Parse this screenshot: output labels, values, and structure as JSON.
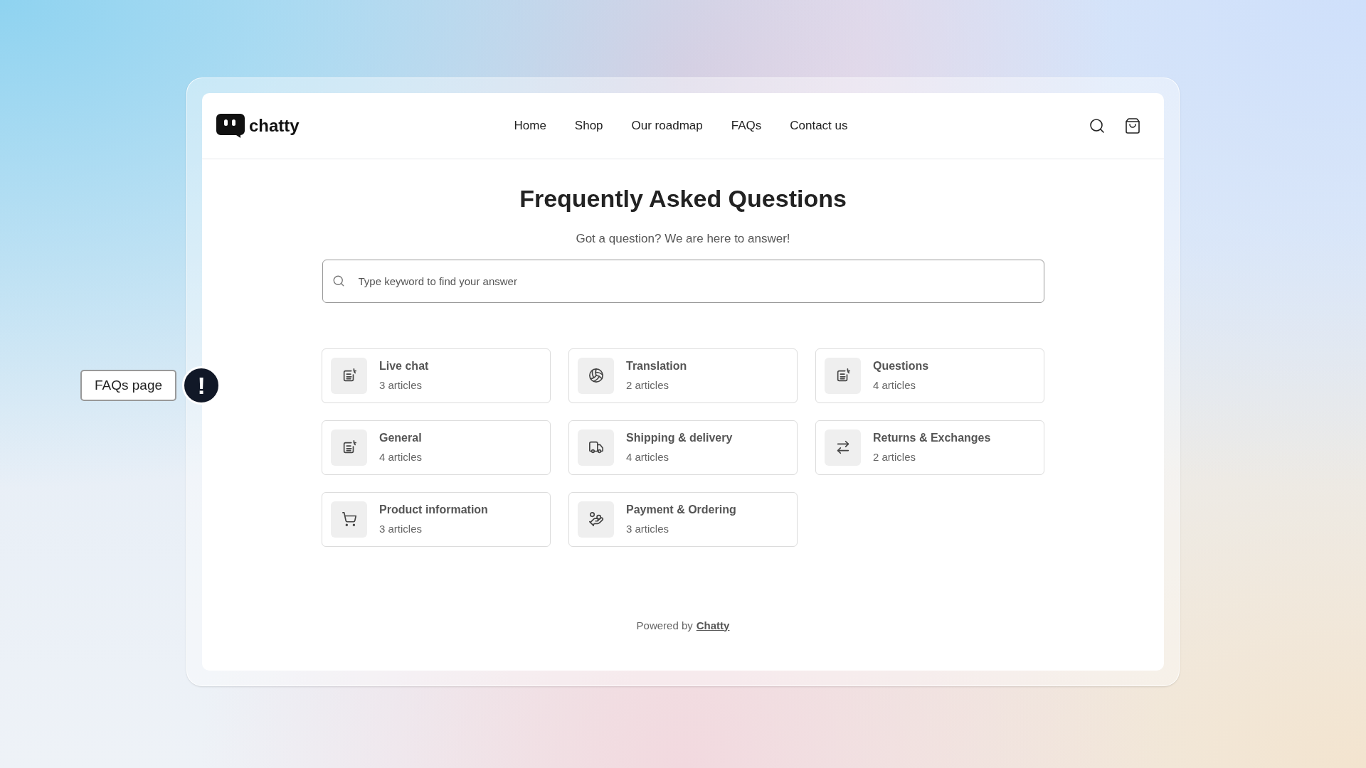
{
  "header": {
    "logo": "chatty",
    "nav": [
      {
        "label": "Home"
      },
      {
        "label": "Shop"
      },
      {
        "label": "Our roadmap"
      },
      {
        "label": "FAQs"
      },
      {
        "label": "Contact us"
      }
    ]
  },
  "page": {
    "title": "Frequently Asked Questions",
    "subtitle": "Got a question? We are here to answer!",
    "search": {
      "placeholder": "Type keyword to find your answer"
    }
  },
  "categories": [
    {
      "name": "Live chat",
      "count": "3 articles"
    },
    {
      "name": "Translation",
      "count": "2 articles"
    },
    {
      "name": "Questions",
      "count": "4 articles"
    },
    {
      "name": "General",
      "count": "4 articles"
    },
    {
      "name": "Shipping & delivery",
      "count": "4 articles"
    },
    {
      "name": "Returns & Exchanges",
      "count": "2 articles"
    },
    {
      "name": "Product information",
      "count": "3 articles"
    },
    {
      "name": "Payment & Ordering",
      "count": "3 articles"
    }
  ],
  "footer": {
    "prefix": "Powered by",
    "link": "Chatty"
  },
  "callout": {
    "label": "FAQs page",
    "mark": "!"
  }
}
